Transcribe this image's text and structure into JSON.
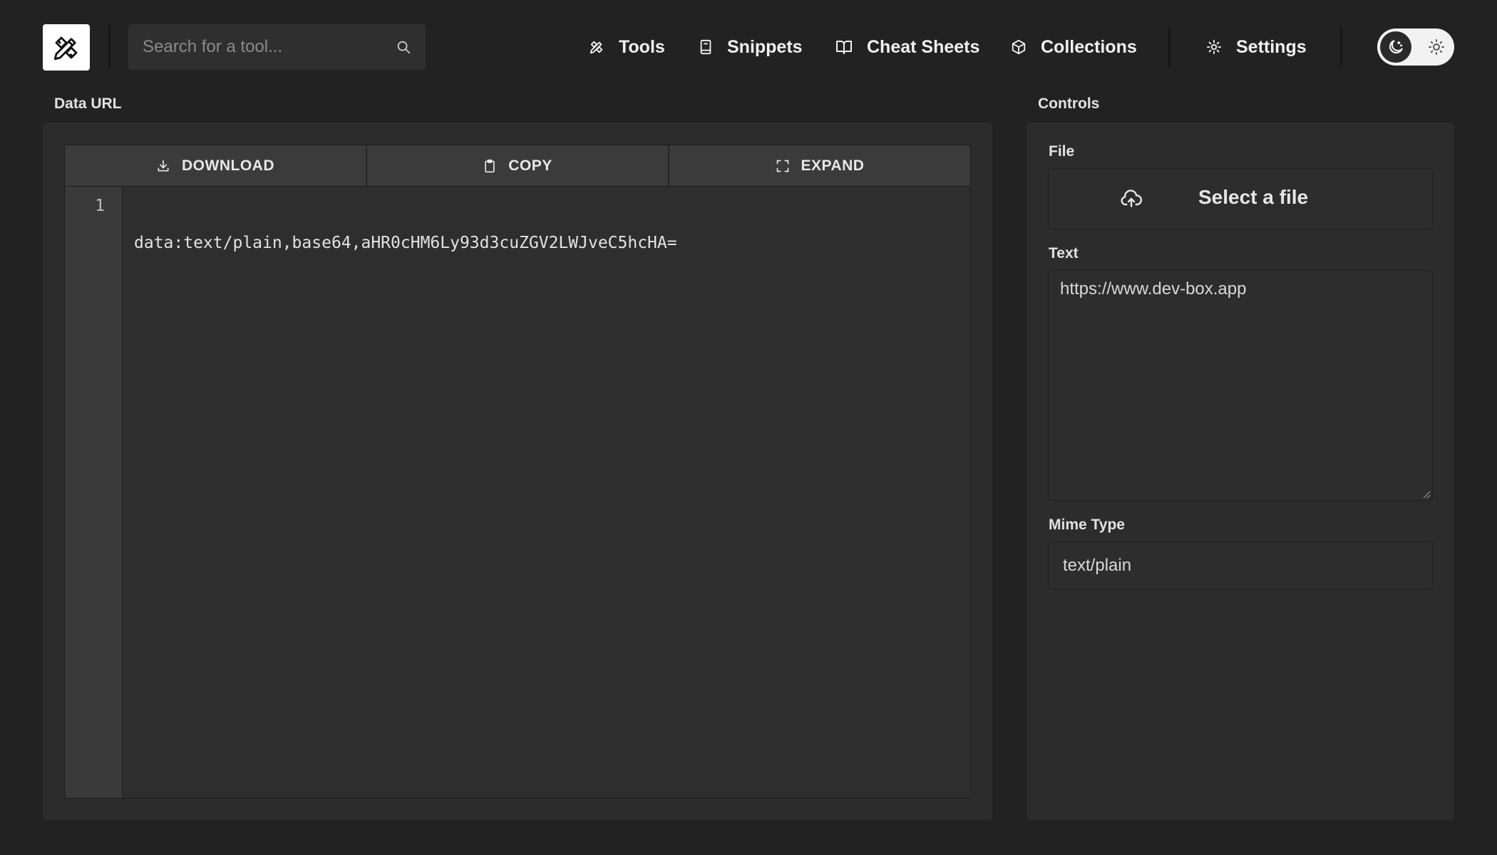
{
  "app": {
    "logo_icon": "tools-logo-icon"
  },
  "search": {
    "placeholder": "Search for a tool...",
    "value": "",
    "icon": "search-icon"
  },
  "nav": {
    "items": [
      {
        "label": "Tools",
        "icon": "tools-icon"
      },
      {
        "label": "Snippets",
        "icon": "snippet-book-icon"
      },
      {
        "label": "Cheat Sheets",
        "icon": "open-book-icon"
      },
      {
        "label": "Collections",
        "icon": "box-icon"
      },
      {
        "label": "Settings",
        "icon": "gear-icon"
      }
    ]
  },
  "theme": {
    "active": "dark",
    "icons": [
      "moon-icon",
      "sun-icon"
    ]
  },
  "output": {
    "title": "Data URL",
    "toolbar": {
      "download_label": "DOWNLOAD",
      "copy_label": "COPY",
      "expand_label": "EXPAND"
    },
    "lines": [
      {
        "number": "1",
        "text": "data:text/plain,base64,aHR0cHM6Ly93d3cuZGV2LWJveC5hcHA="
      }
    ]
  },
  "controls": {
    "title": "Controls",
    "file": {
      "label": "File",
      "button_label": "Select a file",
      "icon": "cloud-upload-icon"
    },
    "text": {
      "label": "Text",
      "value": "https://www.dev-box.app"
    },
    "mime": {
      "label": "Mime Type",
      "value": "text/plain"
    }
  },
  "colors": {
    "background": "#222222",
    "panel": "#2c2c2c",
    "toolbar": "#3b3b3b",
    "gutter": "#3a3a3a"
  }
}
